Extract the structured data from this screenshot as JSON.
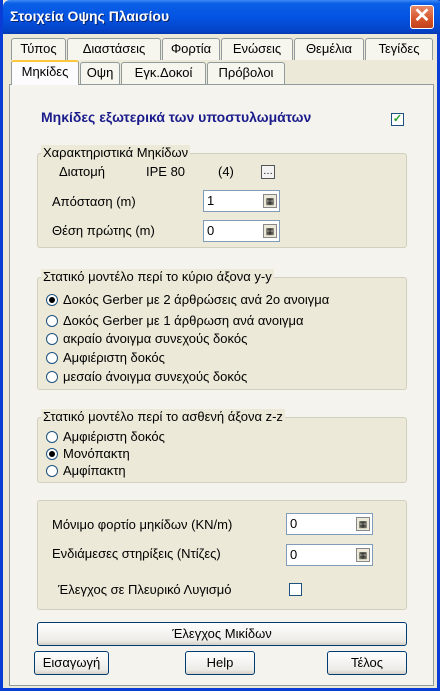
{
  "window": {
    "title": "Στοιχεία Οψης Πλαισίου",
    "close_glyph": "✕"
  },
  "tabs_row1": [
    {
      "label": "Τύπος"
    },
    {
      "label": "Διαστάσεις"
    },
    {
      "label": "Φορτία"
    },
    {
      "label": "Ενώσεις"
    },
    {
      "label": "Θεμέλια"
    },
    {
      "label": "Τεγίδες"
    }
  ],
  "tabs_row2": [
    {
      "label": "Μηκίδες",
      "active": true
    },
    {
      "label": "Οψη"
    },
    {
      "label": "Εγκ.Δοκοί"
    },
    {
      "label": "Πρόβολοι"
    }
  ],
  "heading": {
    "label": "Μηκίδες εξωτερικά των υποστυλωμάτων",
    "checked": true,
    "check_glyph": "✓"
  },
  "characteristics": {
    "title": "Χαρακτηριστικά Μηκίδων",
    "section_label": "Διατομή",
    "section_value": "IPE 80",
    "section_index": "(4)",
    "distance_label": "Απόσταση (m)",
    "distance_value": "1",
    "first_pos_label": "Θέση πρώτης (m)",
    "first_pos_value": "0"
  },
  "model_yy": {
    "title": "Στατικό μοντέλο περί το κύριο άξονα y-y",
    "options": [
      {
        "label": "Δοκός Gerber με 2 άρθρώσεις ανά 2ο ανοιγμα",
        "selected": true
      },
      {
        "label": "Δοκός Gerber με 1 άρθρωση ανά ανοιγμα",
        "selected": false
      },
      {
        "label": "ακραίο άνοιγμα συνεχούς δοκός",
        "selected": false
      },
      {
        "label": "Αμφιέριστη δοκός",
        "selected": false
      },
      {
        "label": "μεσαίο άνοιγμα συνεχούς δοκός",
        "selected": false
      }
    ]
  },
  "model_zz": {
    "title": "Στατικό μοντέλο περί το ασθενή άξονα z-z",
    "options": [
      {
        "label": "Αμφιέριστη δοκός",
        "selected": false
      },
      {
        "label": "Μονόπακτη",
        "selected": true
      },
      {
        "label": "Αμφίπακτη",
        "selected": false
      }
    ]
  },
  "loads": {
    "permanent_label": "Μόνιμο φορτίο μηκίδων (KN/m)",
    "permanent_value": "0",
    "supports_label": "Ενδιάμεσες στηρίξεις (Ντίζες)",
    "supports_value": "0",
    "lateral_label": "Έλεγχος σε Πλευρικό Λυγισμό",
    "lateral_checked": false
  },
  "buttons": {
    "check": "Έλεγχος Μικίδων",
    "insert": "Εισαγωγή",
    "help": "Help",
    "end": "Τέλος"
  }
}
